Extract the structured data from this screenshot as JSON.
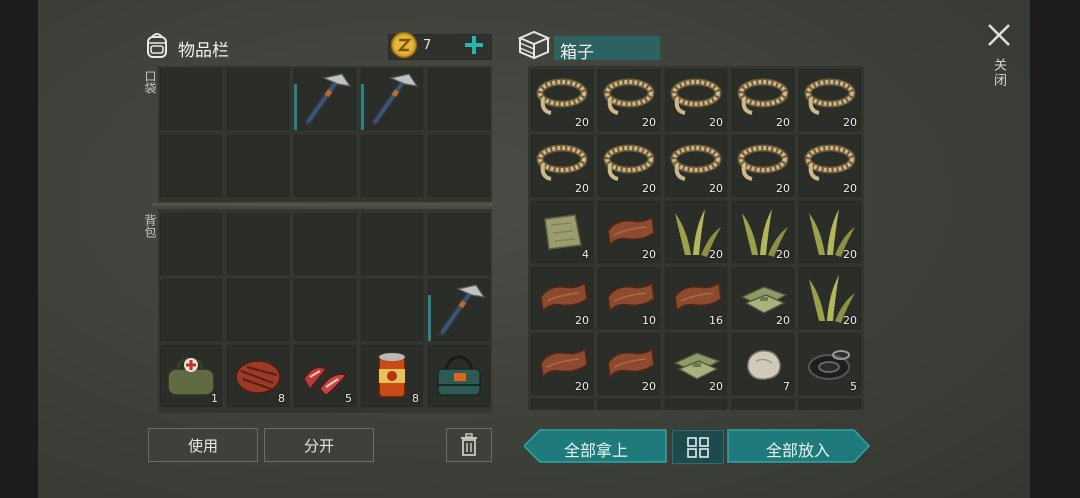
{
  "colors": {
    "accent": "#2a8486",
    "title_bg": "#2d6263",
    "coin": "#d4a12a",
    "plus": "#2bb5b0"
  },
  "header": {
    "inventory_title": "物品栏",
    "coins": "7",
    "box_title": "箱子",
    "close_label": "关闭"
  },
  "labels": {
    "pocket": "口袋",
    "backpack": "背包"
  },
  "pocket_slots": [
    {
      "item": "",
      "qty": ""
    },
    {
      "item": "",
      "qty": ""
    },
    {
      "item": "hatchet",
      "qty": ""
    },
    {
      "item": "hatchet",
      "qty": ""
    },
    {
      "item": "",
      "qty": ""
    },
    {
      "item": "",
      "qty": ""
    },
    {
      "item": "",
      "qty": ""
    },
    {
      "item": "",
      "qty": ""
    },
    {
      "item": "",
      "qty": ""
    },
    {
      "item": "",
      "qty": ""
    }
  ],
  "backpack_slots": [
    {
      "item": "",
      "qty": ""
    },
    {
      "item": "",
      "qty": ""
    },
    {
      "item": "",
      "qty": ""
    },
    {
      "item": "",
      "qty": ""
    },
    {
      "item": "",
      "qty": ""
    },
    {
      "item": "",
      "qty": ""
    },
    {
      "item": "",
      "qty": ""
    },
    {
      "item": "",
      "qty": ""
    },
    {
      "item": "",
      "qty": ""
    },
    {
      "item": "hatchet",
      "qty": ""
    },
    {
      "item": "first-aid-bag",
      "qty": "1"
    },
    {
      "item": "steak",
      "qty": "8"
    },
    {
      "item": "raw-meat",
      "qty": "5"
    },
    {
      "item": "canned-food",
      "qty": "8"
    },
    {
      "item": "supply-pack",
      "qty": ""
    }
  ],
  "box_slots": [
    {
      "item": "rope",
      "qty": "20"
    },
    {
      "item": "rope",
      "qty": "20"
    },
    {
      "item": "rope",
      "qty": "20"
    },
    {
      "item": "rope",
      "qty": "20"
    },
    {
      "item": "rope",
      "qty": "20"
    },
    {
      "item": "rope",
      "qty": "20"
    },
    {
      "item": "rope",
      "qty": "20"
    },
    {
      "item": "rope",
      "qty": "20"
    },
    {
      "item": "rope",
      "qty": "20"
    },
    {
      "item": "rope",
      "qty": "20"
    },
    {
      "item": "cloth",
      "qty": "4"
    },
    {
      "item": "leather",
      "qty": "20"
    },
    {
      "item": "plant-fiber",
      "qty": "20"
    },
    {
      "item": "plant-fiber",
      "qty": "20"
    },
    {
      "item": "plant-fiber",
      "qty": "20"
    },
    {
      "item": "leather",
      "qty": "20"
    },
    {
      "item": "leather",
      "qty": "10"
    },
    {
      "item": "leather",
      "qty": "16"
    },
    {
      "item": "fabric",
      "qty": "20"
    },
    {
      "item": "plant-fiber",
      "qty": "20"
    },
    {
      "item": "leather",
      "qty": "20"
    },
    {
      "item": "leather",
      "qty": "20"
    },
    {
      "item": "fabric",
      "qty": "20"
    },
    {
      "item": "stone",
      "qty": "7"
    },
    {
      "item": "tire-ring",
      "qty": "5"
    }
  ],
  "buttons": {
    "use": "使用",
    "split": "分开",
    "take_all": "全部拿上",
    "put_all": "全部放入"
  }
}
